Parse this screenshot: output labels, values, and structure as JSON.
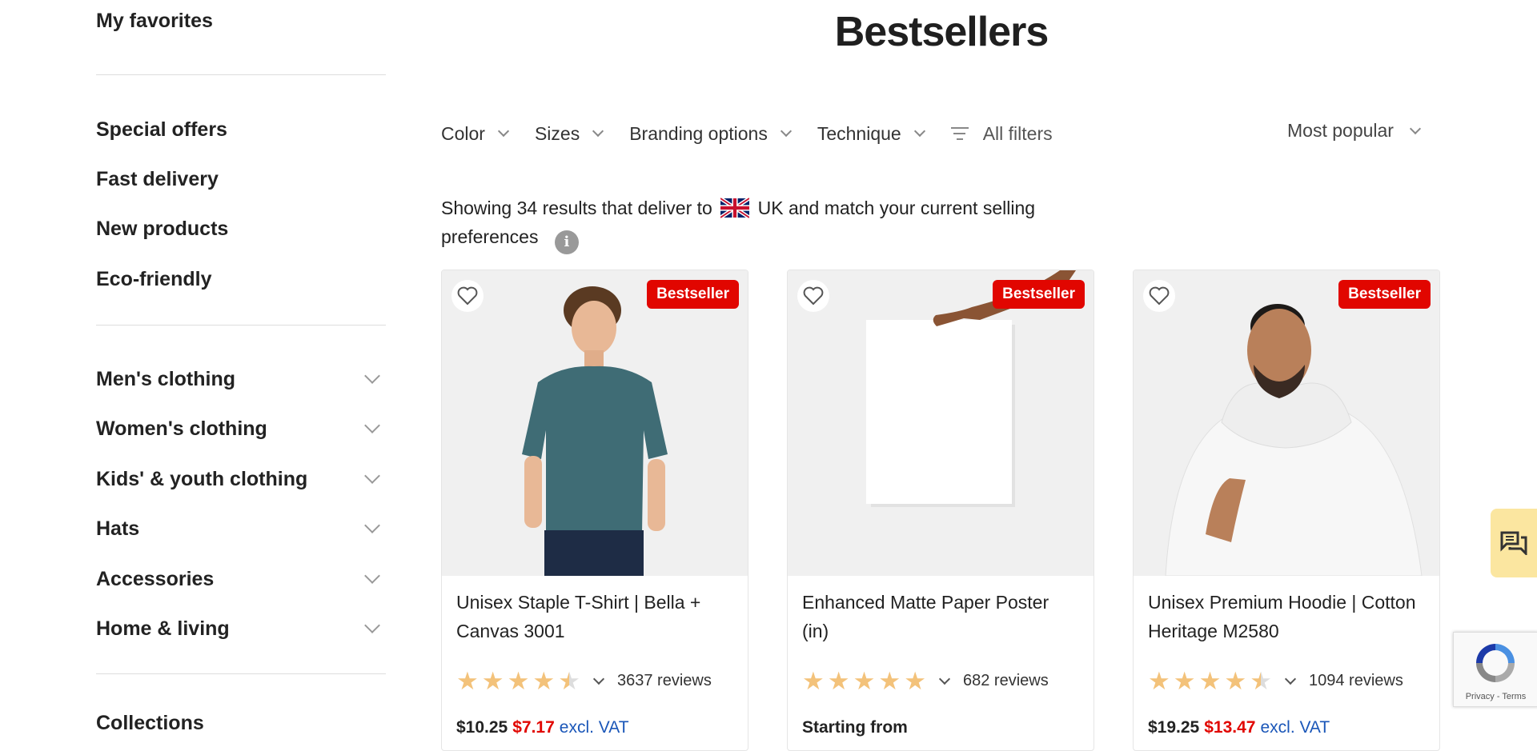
{
  "sidebar": {
    "favorites": "My favorites",
    "quick_links": [
      "Special offers",
      "Fast delivery",
      "New products",
      "Eco-friendly"
    ],
    "categories": [
      "Men's clothing",
      "Women's clothing",
      "Kids' & youth clothing",
      "Hats",
      "Accessories",
      "Home & living"
    ],
    "next_section_partial": "Collections"
  },
  "page": {
    "title": "Bestsellers"
  },
  "filters": {
    "items": [
      "Color",
      "Sizes",
      "Branding options",
      "Technique"
    ],
    "all_filters": "All filters",
    "sort": "Most popular"
  },
  "results": {
    "prefix": "Showing 34 results that deliver to",
    "country": "UK",
    "suffix": "and match your current selling preferences",
    "info_icon": "i"
  },
  "products": [
    {
      "name": "Unisex Staple T-Shirt | Bella + Canvas 3001",
      "badge": "Bestseller",
      "rating": 4.5,
      "reviews": "3637 reviews",
      "price_old": "$10.25",
      "price_sale": "$7.17",
      "vat": "excl. VAT"
    },
    {
      "name": "Enhanced Matte Paper Poster (in)",
      "badge": "Bestseller",
      "rating": 5,
      "reviews": "682 reviews",
      "price_label": "Starting from"
    },
    {
      "name": "Unisex Premium Hoodie | Cotton Heritage M2580",
      "badge": "Bestseller",
      "rating": 4.5,
      "reviews": "1094 reviews",
      "price_old": "$19.25",
      "price_sale": "$13.47",
      "vat": "excl. VAT"
    }
  ],
  "recaptcha": {
    "text": "Privacy - Terms"
  },
  "colors": {
    "badge": "#e10600",
    "star": "#f3c27a",
    "chat": "#fbe6a0",
    "link": "#1a56b8"
  }
}
